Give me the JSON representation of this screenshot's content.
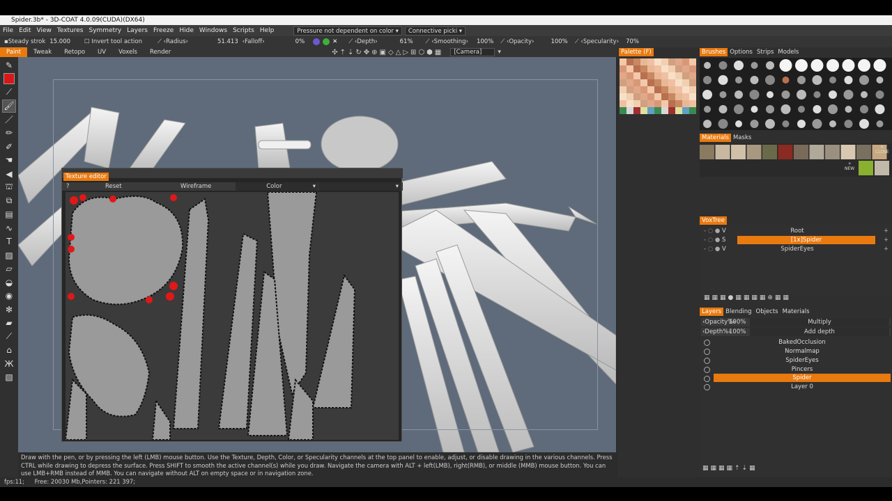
{
  "window": {
    "title": "Spider.3b* - 3D-COAT 4.0.09(CUDA)(DX64)"
  },
  "menu": [
    "File",
    "Edit",
    "View",
    "Textures",
    "Symmetry",
    "Layers",
    "Freeze",
    "Hide",
    "Windows",
    "Scripts",
    "Help"
  ],
  "menu_dropdowns": {
    "pressure": "Pressure not dependent on color",
    "picking": "Connective picki"
  },
  "options": {
    "steady": "Steady strok",
    "steady_val": "15.000",
    "invert": "Invert tool action",
    "radius": "Radius",
    "radius_val": "51.413",
    "falloff": "Falloff",
    "falloff_val": "0%",
    "depth": "Depth",
    "depth_val": "61%",
    "smoothing": "Smoothing",
    "smoothing_val": "100%",
    "opacity": "Opacity",
    "opacity_val": "100%",
    "specularity": "Specularity",
    "specularity_val": "70%",
    "camera": "[Camera]"
  },
  "rooms": [
    "Paint",
    "Tweak",
    "Retopo",
    "UV",
    "Voxels",
    "Render"
  ],
  "active_room": "Paint",
  "texture_editor": {
    "title": "Texture editor",
    "help": "?",
    "reset": "Reset",
    "wireframe": "Wireframe",
    "channel": "Color"
  },
  "palette": {
    "tab": "Palette (F)"
  },
  "brush_tabs": [
    "Brushes",
    "Options",
    "Strips",
    "Models"
  ],
  "material_tabs": [
    "Materials",
    "Masks"
  ],
  "materials": {
    "close": "CLOSE",
    "new": "NEW"
  },
  "voxtree": {
    "tab": "VoxTree",
    "items": [
      {
        "flag": "V",
        "name": "Root"
      },
      {
        "flag": "S",
        "name": "[1x]Spider",
        "selected": true
      },
      {
        "flag": "V",
        "name": "SpiderEyes"
      }
    ]
  },
  "layers": {
    "tabs": [
      "Layers",
      "Blending",
      "Objects",
      "Materials"
    ],
    "opacity_label": "Opacity%",
    "opacity_val": "100%",
    "blend": "Multiply",
    "depth_label": "Depth%",
    "depth_val": "100%",
    "depth_mode": "Add depth",
    "items": [
      "BakedOcclusion",
      "Normalmap",
      "SpiderEyes",
      "Pincers",
      "Spider",
      "Layer 0"
    ],
    "selected": "Spider"
  },
  "status": {
    "hint": "Draw with the pen, or by pressing the left (LMB) mouse button. Use the Texture, Depth, Color, or Specularity channels at the top panel to enable, adjust, or disable drawing in the various channels. Press CTRL while drawing to depress the surface. Press SHIFT to smooth the active channel(s) while you draw. Navigate the camera with ALT + left(LMB), right(RMB), or middle (MMB) mouse button. You can use LMB+RMB instead of MMB. You can navigate without ALT on empty space or in navigation zone.",
    "fps": "fps:11;",
    "memory": "Free: 20030 Mb,Pointers: 221 397;"
  },
  "colors": {
    "accent": "#e87a10",
    "viewport": "#5f6b7a"
  }
}
